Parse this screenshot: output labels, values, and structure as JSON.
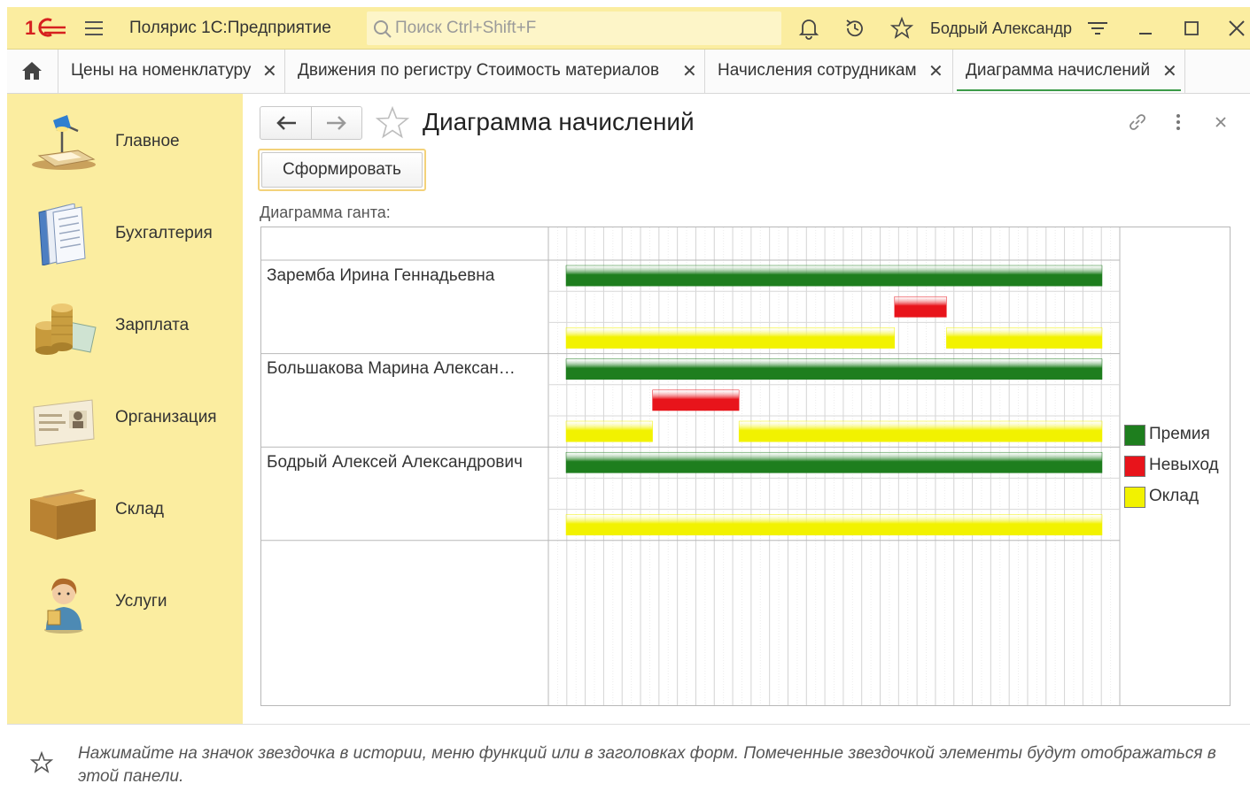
{
  "topbar": {
    "app_title": "Полярис 1С:Предприятие",
    "search_placeholder": "Поиск Ctrl+Shift+F",
    "user_name": "Бодрый Александр"
  },
  "tabs": [
    {
      "label": "Цены на номенклатуру"
    },
    {
      "label": "Движения по регистру Стоимость материалов"
    },
    {
      "label": "Начисления сотрудникам"
    },
    {
      "label": "Диаграмма начислений",
      "active": true
    }
  ],
  "sidebar": {
    "items": [
      {
        "label": "Главное",
        "icon": "desk-lamp-icon"
      },
      {
        "label": "Бухгалтерия",
        "icon": "ledger-books-icon"
      },
      {
        "label": "Зарплата",
        "icon": "coins-icon"
      },
      {
        "label": "Организация",
        "icon": "organization-card-icon"
      },
      {
        "label": "Склад",
        "icon": "box-icon"
      },
      {
        "label": "Услуги",
        "icon": "service-person-icon"
      }
    ]
  },
  "form": {
    "title": "Диаграмма начислений",
    "generate_button": "Сформировать",
    "gantt_label": "Диаграмма ганта:"
  },
  "gantt": {
    "columns": 31,
    "employees": [
      {
        "name": "Заремба Ирина Геннадьевна",
        "rows": [
          {
            "series": "Премия",
            "segments": [
              [
                1,
                31
              ]
            ]
          },
          {
            "series": "Невыход",
            "segments": [
              [
                20,
                22
              ]
            ]
          },
          {
            "series": "Оклад",
            "segments": [
              [
                1,
                19
              ],
              [
                23,
                31
              ]
            ]
          }
        ]
      },
      {
        "name": "Большакова Марина Алексан…",
        "rows": [
          {
            "series": "Премия",
            "segments": [
              [
                1,
                31
              ]
            ]
          },
          {
            "series": "Невыход",
            "segments": [
              [
                6,
                10
              ]
            ]
          },
          {
            "series": "Оклад",
            "segments": [
              [
                1,
                5
              ],
              [
                11,
                31
              ]
            ]
          }
        ]
      },
      {
        "name": "Бодрый Алексей Александрович",
        "rows": [
          {
            "series": "Премия",
            "segments": [
              [
                1,
                31
              ]
            ]
          },
          {
            "series": "Невыход",
            "segments": []
          },
          {
            "series": "Оклад",
            "segments": [
              [
                1,
                31
              ]
            ]
          }
        ]
      }
    ],
    "legend": [
      {
        "label": "Премия",
        "color": "#1e7e1e"
      },
      {
        "label": "Невыход",
        "color": "#e8141b"
      },
      {
        "label": "Оклад",
        "color": "#f2f200"
      }
    ]
  },
  "bottom_panel": {
    "text": "Нажимайте на значок звездочка в истории, меню функций или в заголовках форм. Помеченные звездочкой элементы будут отображаться в этой панели."
  },
  "colors": {
    "accent_yellow": "#fbeda0",
    "active_tab_underline": "#3c9a48"
  }
}
